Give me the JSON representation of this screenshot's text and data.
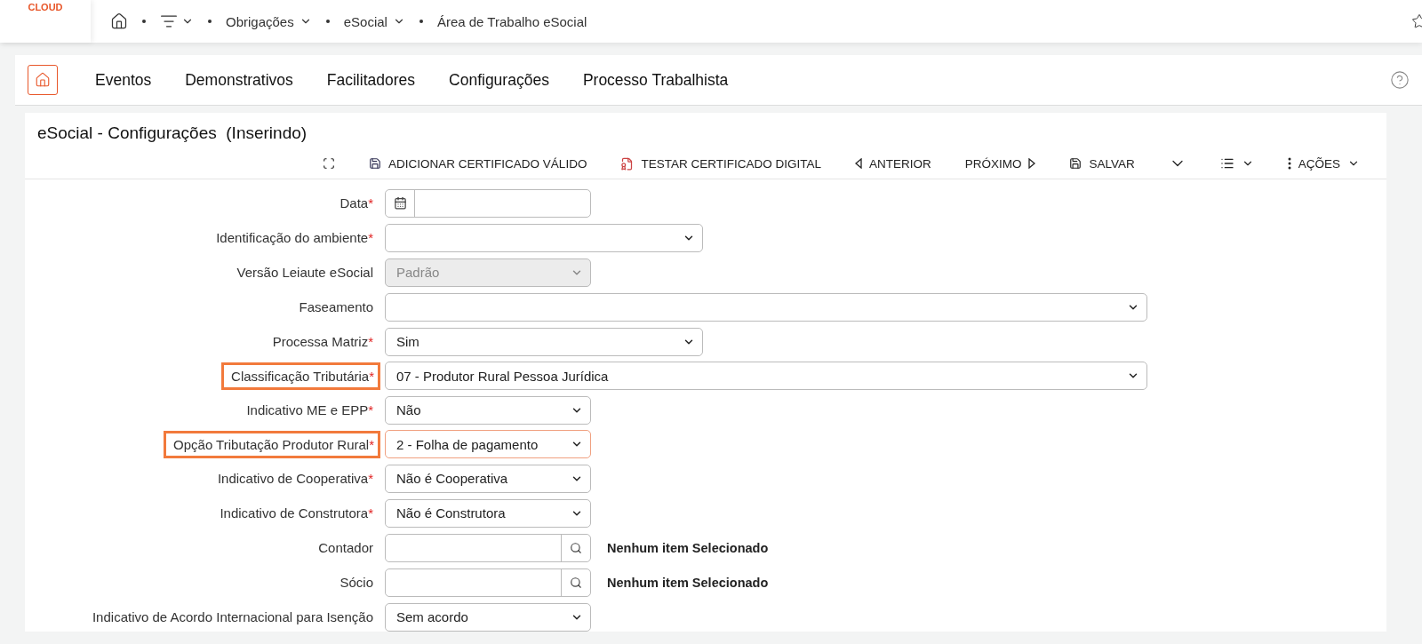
{
  "logo": {
    "text": "CLOUD"
  },
  "breadcrumbs": [
    {
      "label": "Obrigações",
      "dropdown": true
    },
    {
      "label": "eSocial",
      "dropdown": true
    },
    {
      "label": "Área de Trabalho eSocial",
      "dropdown": false
    }
  ],
  "menu": [
    {
      "label": "Eventos"
    },
    {
      "label": "Demonstrativos"
    },
    {
      "label": "Facilitadores"
    },
    {
      "label": "Configurações"
    },
    {
      "label": "Processo Trabalhista"
    }
  ],
  "form": {
    "title": "eSocial - Configurações  (Inserindo)",
    "toolbar": [
      {
        "kind": "icon"
      },
      {
        "kind": "button",
        "label": "ADICIONAR CERTIFICADO VÁLIDO"
      },
      {
        "kind": "button",
        "label": "TESTAR CERTIFICADO DIGITAL"
      },
      {
        "kind": "button",
        "label": "ANTERIOR"
      },
      {
        "kind": "button",
        "label": "PRÓXIMO"
      },
      {
        "kind": "button",
        "label": "SALVAR"
      },
      {
        "kind": "icon"
      },
      {
        "kind": "icon"
      },
      {
        "kind": "button",
        "label": "AÇÕES"
      }
    ],
    "fields": [
      {
        "label": "Data",
        "required_mark": "*",
        "highlighted": false,
        "kind": "date",
        "disabled": false,
        "focused": false
      },
      {
        "label": "Identificação do ambiente",
        "required_mark": "*",
        "highlighted": false,
        "kind": "select",
        "disabled": false,
        "focused": false
      },
      {
        "label": "Versão Leiaute eSocial",
        "highlighted": false,
        "kind": "select",
        "value": "Padrão",
        "disabled": true,
        "focused": false
      },
      {
        "label": "Faseamento",
        "highlighted": false,
        "kind": "select",
        "disabled": false,
        "focused": false
      },
      {
        "label": "Processa Matriz",
        "required_mark": "*",
        "highlighted": false,
        "kind": "select",
        "value": "Sim",
        "disabled": false,
        "focused": false
      },
      {
        "label": "Classificação Tributária",
        "required_mark": "*",
        "highlighted": true,
        "kind": "select",
        "value": "07 - Produtor Rural Pessoa Jurídica",
        "disabled": false,
        "focused": false
      },
      {
        "label": "Indicativo ME e EPP",
        "required_mark": "*",
        "highlighted": false,
        "kind": "select",
        "value": "Não",
        "disabled": false,
        "focused": false
      },
      {
        "label": "Opção Tributação Produtor Rural",
        "required_mark": "*",
        "highlighted": true,
        "kind": "select",
        "value": "2 - Folha de pagamento",
        "disabled": false,
        "focused": true
      },
      {
        "label": "Indicativo de Cooperativa",
        "required_mark": "*",
        "highlighted": false,
        "kind": "select",
        "value": "Não é Cooperativa",
        "disabled": false,
        "focused": false
      },
      {
        "label": "Indicativo de Construtora",
        "required_mark": "*",
        "highlighted": false,
        "kind": "select",
        "value": "Não é Construtora",
        "disabled": false,
        "focused": false
      },
      {
        "label": "Contador",
        "highlighted": false,
        "kind": "search",
        "note": "Nenhum item Selecionado",
        "disabled": false,
        "focused": false
      },
      {
        "label": "Sócio",
        "highlighted": false,
        "kind": "search",
        "note": "Nenhum item Selecionado",
        "disabled": false,
        "focused": false
      },
      {
        "label": "Indicativo de Acordo Internacional para Isenção",
        "highlighted": false,
        "kind": "select",
        "value": "Sem acordo",
        "disabled": false,
        "focused": false
      }
    ]
  }
}
